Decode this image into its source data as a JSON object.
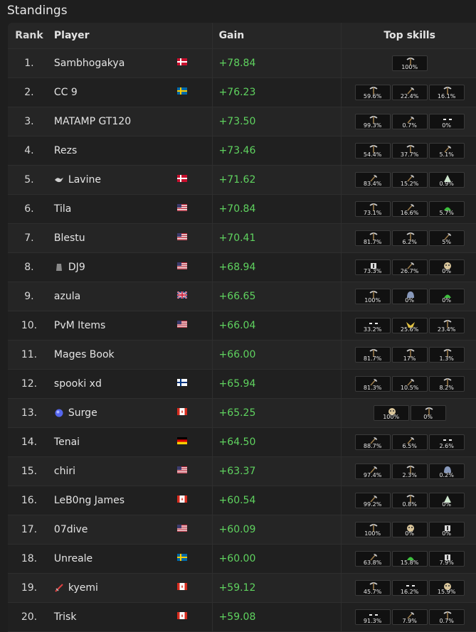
{
  "page": {
    "title": "Standings"
  },
  "headers": {
    "rank": "Rank",
    "player": "Player",
    "gain": "Gain",
    "skills": "Top skills"
  },
  "rows": [
    {
      "rank": "1.",
      "player": "Sambhogakya",
      "flag": "dk",
      "icon": null,
      "gain": "+78.84",
      "skills": [
        {
          "pct": "100%",
          "icon": "pickaxe-icon"
        }
      ]
    },
    {
      "rank": "2.",
      "player": "CC 9",
      "flag": "se",
      "icon": null,
      "gain": "+76.23",
      "skills": [
        {
          "pct": "59.6%",
          "icon": "pickaxe-icon"
        },
        {
          "pct": "22.4%",
          "icon": "axe-icon"
        },
        {
          "pct": "16.1%",
          "icon": "pickaxe-icon"
        }
      ]
    },
    {
      "rank": "3.",
      "player": "MATAMP GT120",
      "flag": null,
      "icon": null,
      "gain": "+73.50",
      "skills": [
        {
          "pct": "99.3%",
          "icon": "pickaxe-icon"
        },
        {
          "pct": "0.7%",
          "icon": "axe-icon"
        },
        {
          "pct": "0%",
          "icon": "mask-icon"
        }
      ]
    },
    {
      "rank": "4.",
      "player": "Rezs",
      "flag": null,
      "icon": null,
      "gain": "+73.46",
      "skills": [
        {
          "pct": "54.4%",
          "icon": "pickaxe-icon"
        },
        {
          "pct": "37.7%",
          "icon": "pickaxe-icon"
        },
        {
          "pct": "5.1%",
          "icon": "axe-icon"
        }
      ]
    },
    {
      "rank": "5.",
      "player": "Lavine",
      "flag": "dk",
      "icon": "bird-icon",
      "gain": "+71.62",
      "skills": [
        {
          "pct": "83.4%",
          "icon": "axe-icon"
        },
        {
          "pct": "15.2%",
          "icon": "axe-icon"
        },
        {
          "pct": "0.9%",
          "icon": "leaf-icon"
        }
      ]
    },
    {
      "rank": "6.",
      "player": "Tila",
      "flag": "us",
      "icon": null,
      "gain": "+70.84",
      "skills": [
        {
          "pct": "73.1%",
          "icon": "pickaxe-icon"
        },
        {
          "pct": "16.6%",
          "icon": "axe-icon"
        },
        {
          "pct": "5.7%",
          "icon": "herb-icon"
        }
      ]
    },
    {
      "rank": "7.",
      "player": "Blestu",
      "flag": "us",
      "icon": null,
      "gain": "+70.41",
      "skills": [
        {
          "pct": "81.7%",
          "icon": "pickaxe-icon"
        },
        {
          "pct": "6.2%",
          "icon": "pickaxe-icon"
        },
        {
          "pct": "5%",
          "icon": "axe-icon"
        }
      ]
    },
    {
      "rank": "8.",
      "player": "DJ9",
      "flag": "us",
      "icon": "armour-icon",
      "gain": "+68.94",
      "skills": [
        {
          "pct": "73.3%",
          "icon": "square-icon"
        },
        {
          "pct": "26.7%",
          "icon": "axe-icon"
        },
        {
          "pct": "0%",
          "icon": "skull-icon"
        }
      ]
    },
    {
      "rank": "9.",
      "player": "azula",
      "flag": "gb",
      "icon": null,
      "gain": "+66.65",
      "skills": [
        {
          "pct": "100%",
          "icon": "pickaxe-icon"
        },
        {
          "pct": "0%",
          "icon": "helm-icon"
        },
        {
          "pct": "0%",
          "icon": "herb-icon"
        }
      ]
    },
    {
      "rank": "10.",
      "player": "PvM Items",
      "flag": "us",
      "icon": null,
      "gain": "+66.04",
      "skills": [
        {
          "pct": "33.2%",
          "icon": "mask-icon"
        },
        {
          "pct": "25.6%",
          "icon": "wings-icon"
        },
        {
          "pct": "23.4%",
          "icon": "pickaxe-icon"
        }
      ]
    },
    {
      "rank": "11.",
      "player": "Mages Book",
      "flag": null,
      "icon": null,
      "gain": "+66.00",
      "skills": [
        {
          "pct": "81.7%",
          "icon": "pickaxe-icon"
        },
        {
          "pct": "17%",
          "icon": "pickaxe-icon"
        },
        {
          "pct": "1.3%",
          "icon": "pickaxe-icon"
        }
      ]
    },
    {
      "rank": "12.",
      "player": "spooki xd",
      "flag": "fi",
      "icon": null,
      "gain": "+65.94",
      "skills": [
        {
          "pct": "81.3%",
          "icon": "axe-icon"
        },
        {
          "pct": "10.5%",
          "icon": "axe-icon"
        },
        {
          "pct": "8.2%",
          "icon": "pickaxe-icon"
        }
      ]
    },
    {
      "rank": "13.",
      "player": "Surge",
      "flag": "ca",
      "icon": "orb-icon",
      "gain": "+65.25",
      "skills": [
        {
          "pct": "100%",
          "icon": "skull-icon"
        },
        {
          "pct": "0%",
          "icon": "pickaxe-icon"
        }
      ]
    },
    {
      "rank": "14.",
      "player": "Tenai",
      "flag": "de",
      "icon": null,
      "gain": "+64.50",
      "skills": [
        {
          "pct": "88.7%",
          "icon": "axe-icon"
        },
        {
          "pct": "6.5%",
          "icon": "axe-icon"
        },
        {
          "pct": "2.6%",
          "icon": "mask-icon"
        }
      ]
    },
    {
      "rank": "15.",
      "player": "chiri",
      "flag": "us",
      "icon": null,
      "gain": "+63.37",
      "skills": [
        {
          "pct": "97.4%",
          "icon": "axe-icon"
        },
        {
          "pct": "2.3%",
          "icon": "pickaxe-icon"
        },
        {
          "pct": "0.2%",
          "icon": "helm-icon"
        }
      ]
    },
    {
      "rank": "16.",
      "player": "LeB0ng James",
      "flag": "ca",
      "icon": null,
      "gain": "+60.54",
      "skills": [
        {
          "pct": "99.2%",
          "icon": "axe-icon"
        },
        {
          "pct": "0.8%",
          "icon": "pickaxe-icon"
        },
        {
          "pct": "0%",
          "icon": "leaf-icon"
        }
      ]
    },
    {
      "rank": "17.",
      "player": "07dive",
      "flag": "us",
      "icon": null,
      "gain": "+60.09",
      "skills": [
        {
          "pct": "100%",
          "icon": "pickaxe-icon"
        },
        {
          "pct": "0%",
          "icon": "skull-icon"
        },
        {
          "pct": "0%",
          "icon": "square-icon"
        }
      ]
    },
    {
      "rank": "18.",
      "player": "Unreale",
      "flag": "se",
      "icon": null,
      "gain": "+60.00",
      "skills": [
        {
          "pct": "63.8%",
          "icon": "axe-icon"
        },
        {
          "pct": "15.8%",
          "icon": "herb-icon"
        },
        {
          "pct": "7.9%",
          "icon": "square-icon"
        }
      ]
    },
    {
      "rank": "19.",
      "player": "kyemi",
      "flag": "ca",
      "icon": "sword-icon",
      "gain": "+59.12",
      "skills": [
        {
          "pct": "45.7%",
          "icon": "pickaxe-icon"
        },
        {
          "pct": "16.2%",
          "icon": "mask-icon"
        },
        {
          "pct": "15.9%",
          "icon": "skull-icon"
        }
      ]
    },
    {
      "rank": "20.",
      "player": "Trisk",
      "flag": "ca",
      "icon": null,
      "gain": "+59.08",
      "skills": [
        {
          "pct": "91.3%",
          "icon": "mask-icon"
        },
        {
          "pct": "7.9%",
          "icon": "axe-icon"
        },
        {
          "pct": "0.7%",
          "icon": "pickaxe-icon"
        }
      ]
    }
  ]
}
